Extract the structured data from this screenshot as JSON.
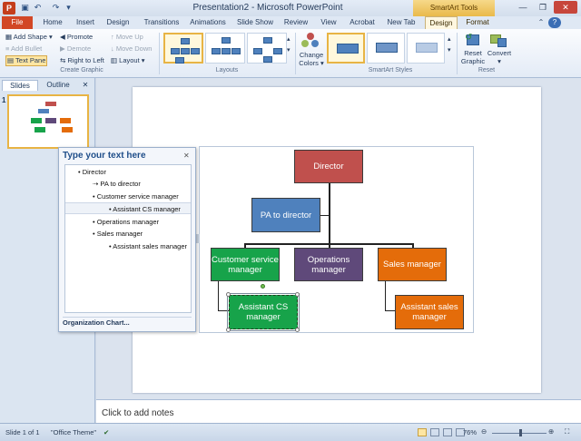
{
  "window": {
    "title": "Presentation2 - Microsoft PowerPoint",
    "context_tab_group": "SmartArt Tools",
    "app_icon": "P",
    "qat_icons": [
      "save-icon",
      "undo-icon",
      "redo-icon"
    ]
  },
  "tabs": [
    "File",
    "Home",
    "Insert",
    "Design",
    "Transitions",
    "Animations",
    "Slide Show",
    "Review",
    "View",
    "Acrobat",
    "New Tab",
    "Design",
    "Format"
  ],
  "ribbon": {
    "create_graphic": {
      "add_shape": "Add Shape",
      "add_bullet": "Add Bullet",
      "text_pane": "Text Pane",
      "promote": "Promote",
      "demote": "Demote",
      "right_to_left": "Right to Left",
      "move_up": "Move Up",
      "move_down": "Move Down",
      "layout": "Layout",
      "label": "Create Graphic"
    },
    "layouts": {
      "label": "Layouts"
    },
    "smartart_styles": {
      "change_colors_1": "Change",
      "change_colors_2": "Colors",
      "label": "SmartArt Styles"
    },
    "reset": {
      "reset_graphic_1": "Reset",
      "reset_graphic_2": "Graphic",
      "convert": "Convert",
      "label": "Reset"
    }
  },
  "slides_pane": {
    "tab_slides": "Slides",
    "tab_outline": "Outline",
    "slide_number": "1"
  },
  "text_pane": {
    "title": "Type your text here",
    "items": [
      "Director",
      "PA to director",
      "Customer service manager",
      "Assistant CS manager",
      "Operations manager",
      "Sales manager",
      "Assistant sales manager"
    ],
    "footer": "Organization Chart..."
  },
  "org_chart": {
    "director": "Director",
    "pa": "PA to director",
    "csm": "Customer service manager",
    "ops": "Operations manager",
    "sales": "Sales manager",
    "acs": "Assistant CS manager",
    "asales": "Assistant sales manager",
    "colors": {
      "director": "#c0504d",
      "pa": "#4f81bd",
      "csm": "#17a34a",
      "ops": "#5f497a",
      "sales": "#e46c0a",
      "acs": "#17a34a",
      "asales": "#e46c0a"
    }
  },
  "notes": {
    "placeholder": "Click to add notes"
  },
  "status": {
    "slide": "Slide 1 of 1",
    "theme": "\"Office Theme\"",
    "zoom": "76%"
  }
}
